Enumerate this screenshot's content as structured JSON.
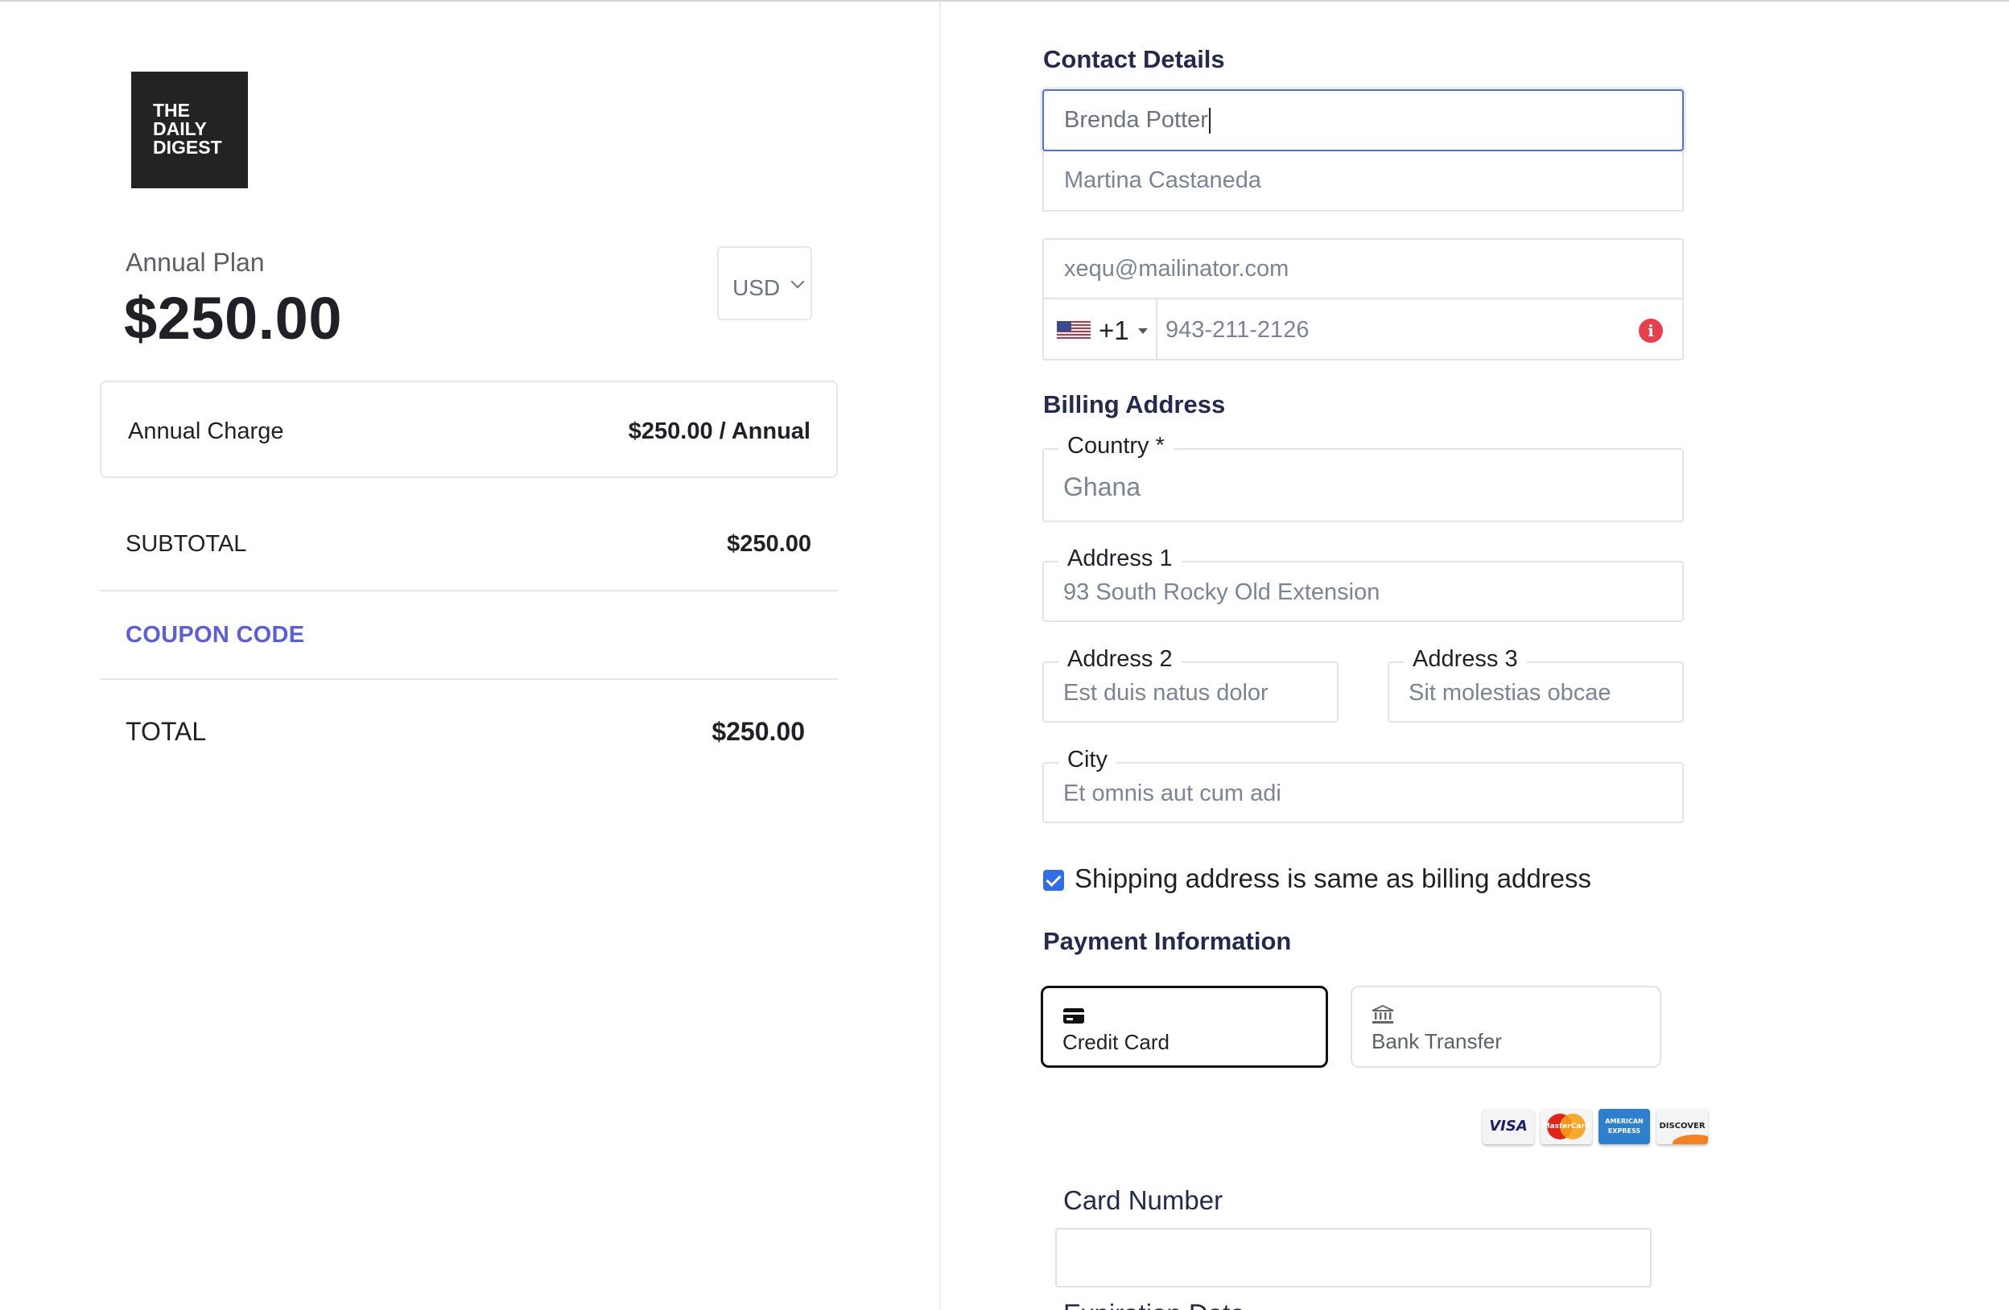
{
  "brand": {
    "logo_lines": [
      "THE",
      "DAILY",
      "DIGEST"
    ]
  },
  "plan": {
    "name": "Annual Plan",
    "price": "$250.00",
    "currency": "USD",
    "charge_label": "Annual Charge",
    "charge_value": "$250.00 / Annual"
  },
  "summary": {
    "subtotal_label": "SUBTOTAL",
    "subtotal_value": "$250.00",
    "coupon_label": "COUPON CODE",
    "total_label": "TOTAL",
    "total_value": "$250.00"
  },
  "contact": {
    "title": "Contact Details",
    "first_name": "Brenda Potter",
    "last_name": "Martina Castaneda",
    "email": "xequ@mailinator.com",
    "phone_code": "+1",
    "phone_number": "943-211-2126",
    "phone_error_icon": "info-icon"
  },
  "billing": {
    "title": "Billing Address",
    "country_label": "Country *",
    "country_value": "Ghana",
    "address1_label": "Address 1",
    "address1_value": "93 South Rocky Old Extension",
    "address2_label": "Address 2",
    "address2_value": "Est duis natus dolor",
    "address3_label": "Address 3",
    "address3_value": "Sit molestias obcae",
    "city_label": "City",
    "city_value": "Et omnis aut cum adi",
    "shipping_same_label": "Shipping address is same as billing address",
    "shipping_same_checked": true
  },
  "payment": {
    "title": "Payment Information",
    "options": [
      {
        "label": "Credit Card",
        "icon": "credit-card-icon",
        "selected": true
      },
      {
        "label": "Bank Transfer",
        "icon": "bank-icon",
        "selected": false
      }
    ],
    "card_brands": [
      "VISA",
      "MasterCard",
      "AMERICAN EXPRESS",
      "DISCOVER"
    ],
    "card_number_label": "Card Number",
    "expiration_label": "Expiration Date"
  },
  "colors": {
    "accent": "#5a5fd8",
    "focus_border": "#4f6de5",
    "heading": "#232a4d",
    "error": "#e5404b",
    "checkbox": "#2f6ee6"
  }
}
